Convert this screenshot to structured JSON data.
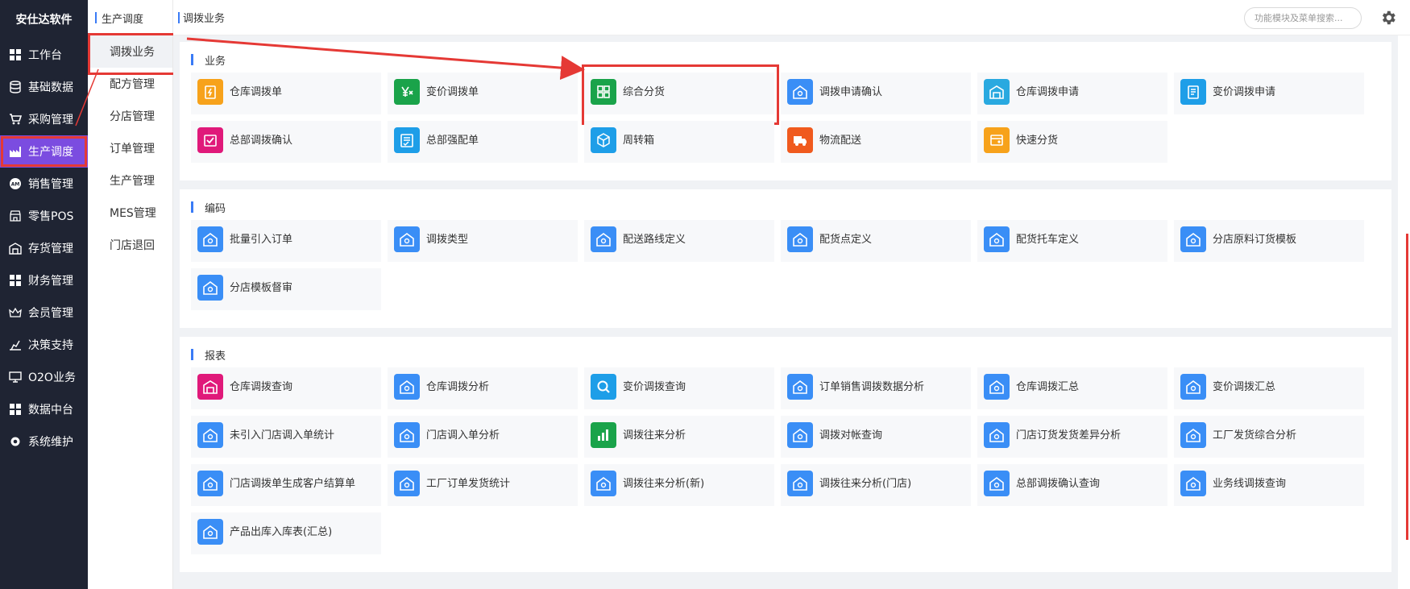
{
  "brand": "安仕达软件",
  "sidebar": {
    "items": [
      {
        "label": "工作台",
        "icon": "grid-icon"
      },
      {
        "label": "基础数据",
        "icon": "database-icon"
      },
      {
        "label": "采购管理",
        "icon": "cart-icon"
      },
      {
        "label": "生产调度",
        "icon": "factory-icon",
        "active": true
      },
      {
        "label": "销售管理",
        "icon": "sale-badge-icon"
      },
      {
        "label": "零售POS",
        "icon": "store-icon"
      },
      {
        "label": "存货管理",
        "icon": "warehouse-icon"
      },
      {
        "label": "财务管理",
        "icon": "grid-icon"
      },
      {
        "label": "会员管理",
        "icon": "crown-icon"
      },
      {
        "label": "决策支持",
        "icon": "decision-icon"
      },
      {
        "label": "O2O业务",
        "icon": "monitor-icon"
      },
      {
        "label": "数据中台",
        "icon": "grid-icon"
      },
      {
        "label": "系统维护",
        "icon": "gear-icon"
      }
    ]
  },
  "subnav": {
    "title": "生产调度",
    "items": [
      "调拨业务",
      "配方管理",
      "分店管理",
      "订单管理",
      "生产管理",
      "MES管理",
      "门店退回"
    ]
  },
  "topbar": {
    "title": "调拨业务",
    "search_placeholder": "功能模块及菜单搜索..."
  },
  "sections": [
    {
      "title": "业务",
      "tiles": [
        {
          "label": "仓库调拨单",
          "icon": "doc-bolt-icon",
          "color": "#f7a21b"
        },
        {
          "label": "变价调拨单",
          "icon": "price-change-icon",
          "color": "#1aa34a"
        },
        {
          "label": "综合分货",
          "icon": "four-squares-icon",
          "color": "#1aa34a",
          "highlight": true
        },
        {
          "label": "调拨申请确认",
          "icon": "house-icon",
          "color": "#3a8ef6"
        },
        {
          "label": "仓库调拨申请",
          "icon": "warehouse-icon",
          "color": "#29a9e0"
        },
        {
          "label": "变价调拨申请",
          "icon": "doc-icon",
          "color": "#1e9ee8"
        },
        {
          "label": "总部调拨确认",
          "icon": "check-box-icon",
          "color": "#e0197a"
        },
        {
          "label": "总部强配单",
          "icon": "list-check-icon",
          "color": "#1e9ee8"
        },
        {
          "label": "周转箱",
          "icon": "box-icon",
          "color": "#1e9ee8"
        },
        {
          "label": "物流配送",
          "icon": "truck-icon",
          "color": "#f05a1e"
        },
        {
          "label": "快速分货",
          "icon": "card-icon",
          "color": "#f7a21b"
        }
      ]
    },
    {
      "title": "编码",
      "tiles": [
        {
          "label": "批量引入订单",
          "icon": "house-icon",
          "color": "#3a8ef6"
        },
        {
          "label": "调拨类型",
          "icon": "house-icon",
          "color": "#3a8ef6"
        },
        {
          "label": "配送路线定义",
          "icon": "house-icon",
          "color": "#3a8ef6"
        },
        {
          "label": "配货点定义",
          "icon": "house-icon",
          "color": "#3a8ef6"
        },
        {
          "label": "配货托车定义",
          "icon": "house-icon",
          "color": "#3a8ef6"
        },
        {
          "label": "分店原料订货模板",
          "icon": "house-icon",
          "color": "#3a8ef6"
        },
        {
          "label": "分店模板督审",
          "icon": "house-icon",
          "color": "#3a8ef6"
        }
      ]
    },
    {
      "title": "报表",
      "tiles": [
        {
          "label": "仓库调拨查询",
          "icon": "warehouse-icon",
          "color": "#e0197a"
        },
        {
          "label": "仓库调拨分析",
          "icon": "house-icon",
          "color": "#3a8ef6"
        },
        {
          "label": "变价调拨查询",
          "icon": "magnifier-icon",
          "color": "#1e9ee8"
        },
        {
          "label": "订单销售调拨数据分析",
          "icon": "house-icon",
          "color": "#3a8ef6"
        },
        {
          "label": "仓库调拨汇总",
          "icon": "house-icon",
          "color": "#3a8ef6"
        },
        {
          "label": "变价调拨汇总",
          "icon": "house-icon",
          "color": "#3a8ef6"
        },
        {
          "label": "未引入门店调入单统计",
          "icon": "house-icon",
          "color": "#3a8ef6"
        },
        {
          "label": "门店调入单分析",
          "icon": "house-icon",
          "color": "#3a8ef6"
        },
        {
          "label": "调拨往来分析",
          "icon": "bar-chart-icon",
          "color": "#1aa34a"
        },
        {
          "label": "调拨对帐查询",
          "icon": "house-icon",
          "color": "#3a8ef6"
        },
        {
          "label": "门店订货发货差异分析",
          "icon": "house-icon",
          "color": "#3a8ef6"
        },
        {
          "label": "工厂发货综合分析",
          "icon": "house-icon",
          "color": "#3a8ef6"
        },
        {
          "label": "门店调拨单生成客户结算单",
          "icon": "house-icon",
          "color": "#3a8ef6"
        },
        {
          "label": "工厂订单发货统计",
          "icon": "house-icon",
          "color": "#3a8ef6"
        },
        {
          "label": "调拨往来分析(新)",
          "icon": "house-icon",
          "color": "#3a8ef6"
        },
        {
          "label": "调拨往来分析(门店)",
          "icon": "house-icon",
          "color": "#3a8ef6"
        },
        {
          "label": "总部调拨确认查询",
          "icon": "house-icon",
          "color": "#3a8ef6"
        },
        {
          "label": "业务线调拨查询",
          "icon": "house-icon",
          "color": "#3a8ef6"
        },
        {
          "label": "产品出库入库表(汇总)",
          "icon": "house-icon",
          "color": "#3a8ef6"
        }
      ]
    }
  ],
  "colors": {
    "sidebar_bg": "#1f2433",
    "active_purple": "#7b4ce0",
    "accent_blue": "#3a7bf6",
    "annotation_red": "#e53935"
  }
}
